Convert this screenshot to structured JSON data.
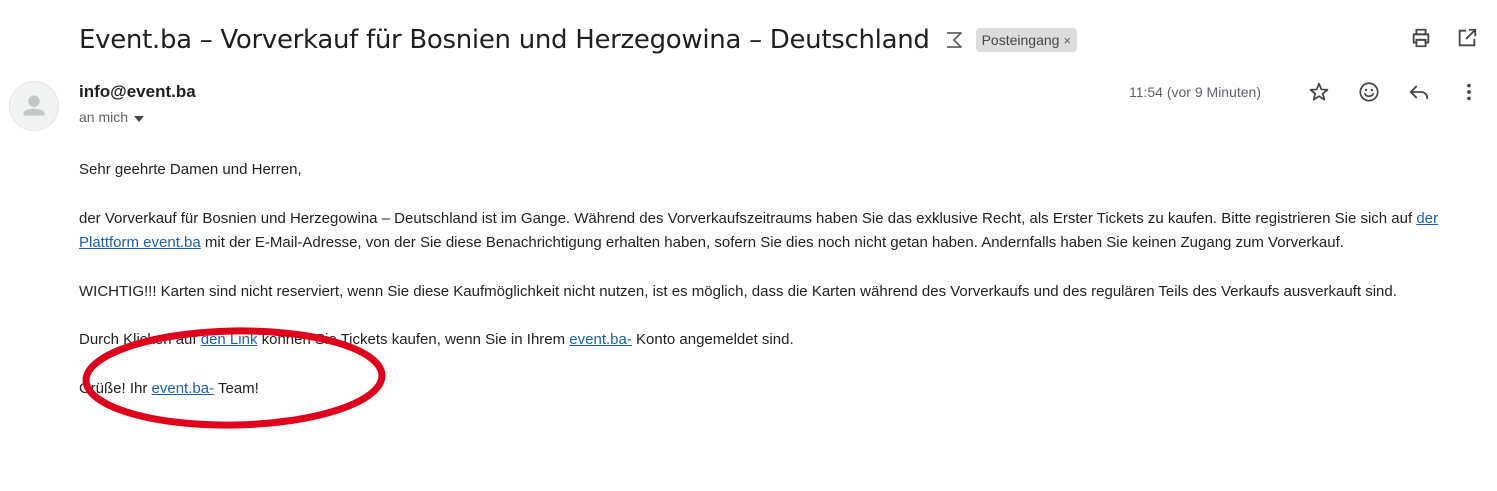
{
  "subject": "Event.ba – Vorverkauf für Bosnien und Herzegowina – Deutschland",
  "label": {
    "name": "Posteingang",
    "remove": "×"
  },
  "toolbar": {
    "print_icon": "print-icon",
    "open_new_window_icon": "open-in-new-window-icon"
  },
  "sender": {
    "email": "info@event.ba",
    "recipient_label": "an mich"
  },
  "timestamp": "11:54 (vor 9 Minuten)",
  "message_actions": {
    "star_icon": "star-icon",
    "emoji_icon": "emoji-reaction-icon",
    "reply_icon": "reply-icon",
    "more_icon": "more-options-icon"
  },
  "body": {
    "greeting": "Sehr geehrte Damen und Herren,",
    "p1_a": "der Vorverkauf für Bosnien und Herzegowina – Deutschland ist im Gange. Während des Vorverkaufszeitraums haben Sie das exklusive Recht, als Erster Tickets zu kaufen. Bitte registrieren Sie sich auf ",
    "p1_link": "der Plattform event.ba",
    "p1_b": " mit der E-Mail-Adresse, von der Sie diese Benachrichtigung erhalten haben, sofern Sie dies noch nicht getan haben. Andernfalls haben Sie keinen Zugang zum Vorverkauf.",
    "p2": "WICHTIG!!! Karten sind nicht reserviert, wenn Sie diese Kaufmöglichkeit nicht nutzen, ist es möglich, dass die Karten während des Vorverkaufs und des regulären Teils des Verkaufs ausverkauft sind.",
    "p3_a": "Durch Klicken auf ",
    "p3_link1": "den Link",
    "p3_b": " können Sie Tickets kaufen, wenn Sie in Ihrem ",
    "p3_link2": "event.ba-",
    "p3_c": " Konto angemeldet sind.",
    "p4_a": "Grüße! Ihr ",
    "p4_link": "event.ba-",
    "p4_b": " Team!"
  },
  "colors": {
    "link": "#1a5fb4",
    "annotation_circle": "#e0001b",
    "chip_bg": "#dddddd"
  }
}
